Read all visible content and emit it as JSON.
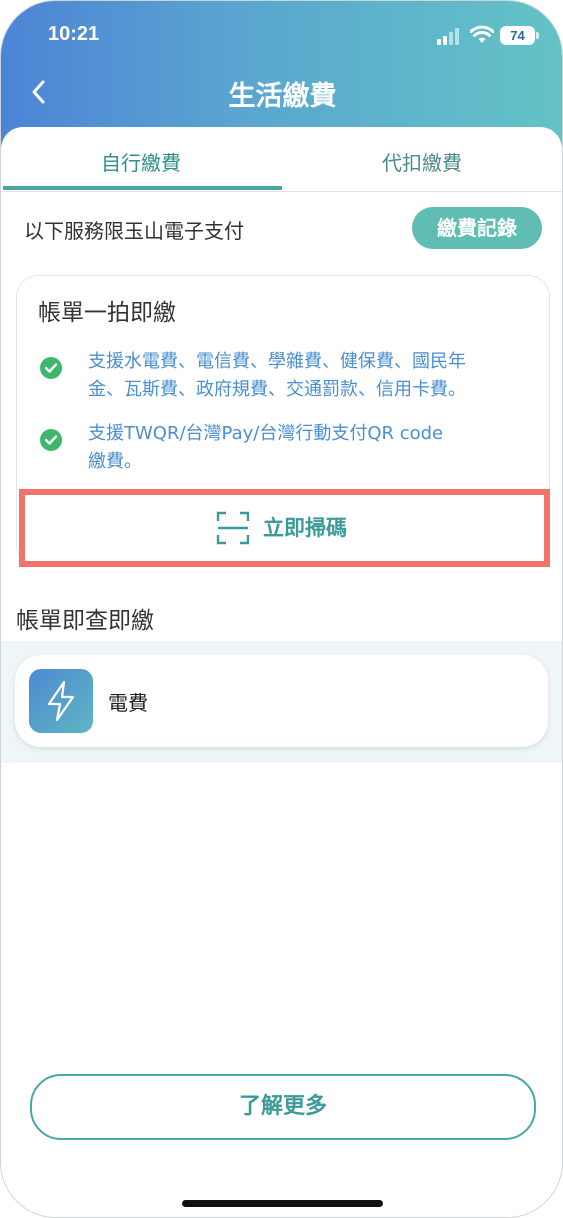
{
  "status_bar": {
    "time": "10:21",
    "battery": "74"
  },
  "header": {
    "title": "生活繳費",
    "back_icon": "chevron-left-icon"
  },
  "tabs": [
    {
      "label": "自行繳費",
      "active": true
    },
    {
      "label": "代扣繳費",
      "active": false
    }
  ],
  "service_note": "以下服務限玉山電子支付",
  "record_button": "繳費記錄",
  "scan_card": {
    "title": "帳單一拍即繳",
    "features": [
      {
        "icon": "check-circle-icon",
        "line1": "支援水電費、電信費、學雜費、健保費、國民年",
        "line2": "金、瓦斯費、政府規費、交通罰款、信用卡費。"
      },
      {
        "icon": "check-circle-icon",
        "line1": "支援TWQR/台灣Pay/台灣行動支付QR code",
        "line2": "繳費。"
      }
    ],
    "scan_button": {
      "label": "立即掃碼",
      "icon": "scan-icon"
    }
  },
  "bill_section": {
    "title": "帳單即查即繳",
    "items": [
      {
        "label": "電費",
        "icon": "lightning-bolt-icon"
      }
    ]
  },
  "learn_more": "了解更多",
  "colors": {
    "accent": "#4aa7a3",
    "highlight": "#f0736c",
    "check": "#3fb66c",
    "link": "#4a8fd0"
  }
}
